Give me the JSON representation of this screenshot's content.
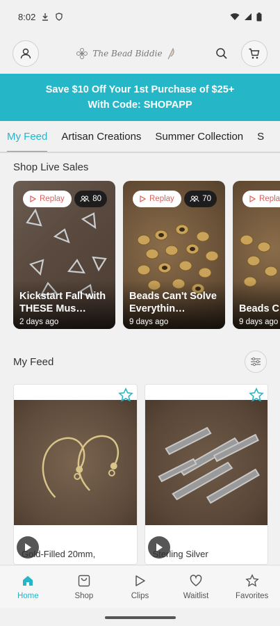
{
  "status_bar": {
    "time": "8:02"
  },
  "header": {
    "brand": "The Bead Biddie"
  },
  "promo": {
    "line1": "Save $10 Off Your 1st Purchase of $25+",
    "line2": "With Code: SHOPAPP"
  },
  "tabs": [
    {
      "label": "My Feed",
      "active": true
    },
    {
      "label": "Artisan Creations",
      "active": false
    },
    {
      "label": "Summer Collection",
      "active": false
    },
    {
      "label": "S",
      "active": false
    }
  ],
  "live_section": {
    "title": "Shop Live Sales"
  },
  "live_cards": [
    {
      "replay": "Replay",
      "viewers": "80",
      "title": "Kickstart Fall with THESE Mus…",
      "time": "2 days ago"
    },
    {
      "replay": "Replay",
      "viewers": "70",
      "title": "Beads Can't Solve Everythin…",
      "time": "9 days ago"
    },
    {
      "replay": "Repla",
      "viewers": "",
      "title": "Beads C Solve Ev",
      "time": "9 days ago"
    }
  ],
  "feed": {
    "title": "My Feed"
  },
  "products": [
    {
      "name": "Gold-Filled 20mm,"
    },
    {
      "name": "Sterling Silver"
    }
  ],
  "nav": [
    {
      "label": "Home",
      "icon": "home-icon",
      "active": true
    },
    {
      "label": "Shop",
      "icon": "shop-icon",
      "active": false
    },
    {
      "label": "Clips",
      "icon": "play-outline-icon",
      "active": false
    },
    {
      "label": "Waitlist",
      "icon": "heart-icon",
      "active": false
    },
    {
      "label": "Favorites",
      "icon": "star-icon",
      "active": false
    }
  ],
  "colors": {
    "accent": "#25b6c8",
    "replay": "#e05b5b"
  }
}
